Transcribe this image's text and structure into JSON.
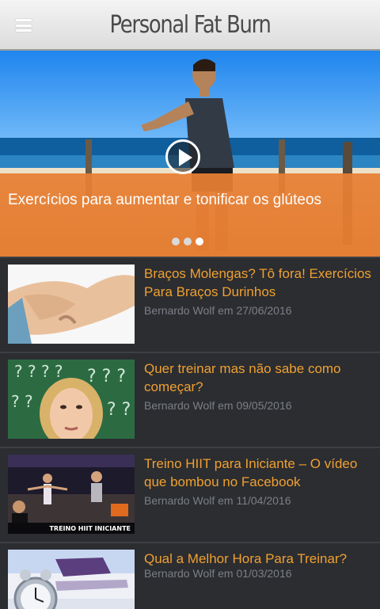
{
  "header": {
    "title": "Personal Fat Burn"
  },
  "hero": {
    "caption": "Exercícios para aumentar e tonificar os glúteos",
    "slide_count": 3,
    "active_slide": 3
  },
  "articles": [
    {
      "title": "Braços Molengas? Tô fora! Exercícios Para Braços Durinhos",
      "meta": "Bernardo Wolf em 27/06/2016"
    },
    {
      "title": "Quer treinar mas não sabe como começar?",
      "meta": "Bernardo Wolf em 09/05/2016"
    },
    {
      "title": "Treino HIIT para Iniciante – O vídeo que bombou no Facebook",
      "meta": "Bernardo Wolf em 11/04/2016",
      "thumb_text": "TREINO HIIT INICIANTE"
    },
    {
      "title": "Qual a Melhor Hora Para Treinar?",
      "meta": "Bernardo Wolf em 01/03/2016"
    }
  ],
  "colors": {
    "accent": "#f0a030",
    "background": "#2b2d31",
    "meta_text": "#7c7f86"
  },
  "icons": [
    "menu-icon",
    "play-icon"
  ]
}
